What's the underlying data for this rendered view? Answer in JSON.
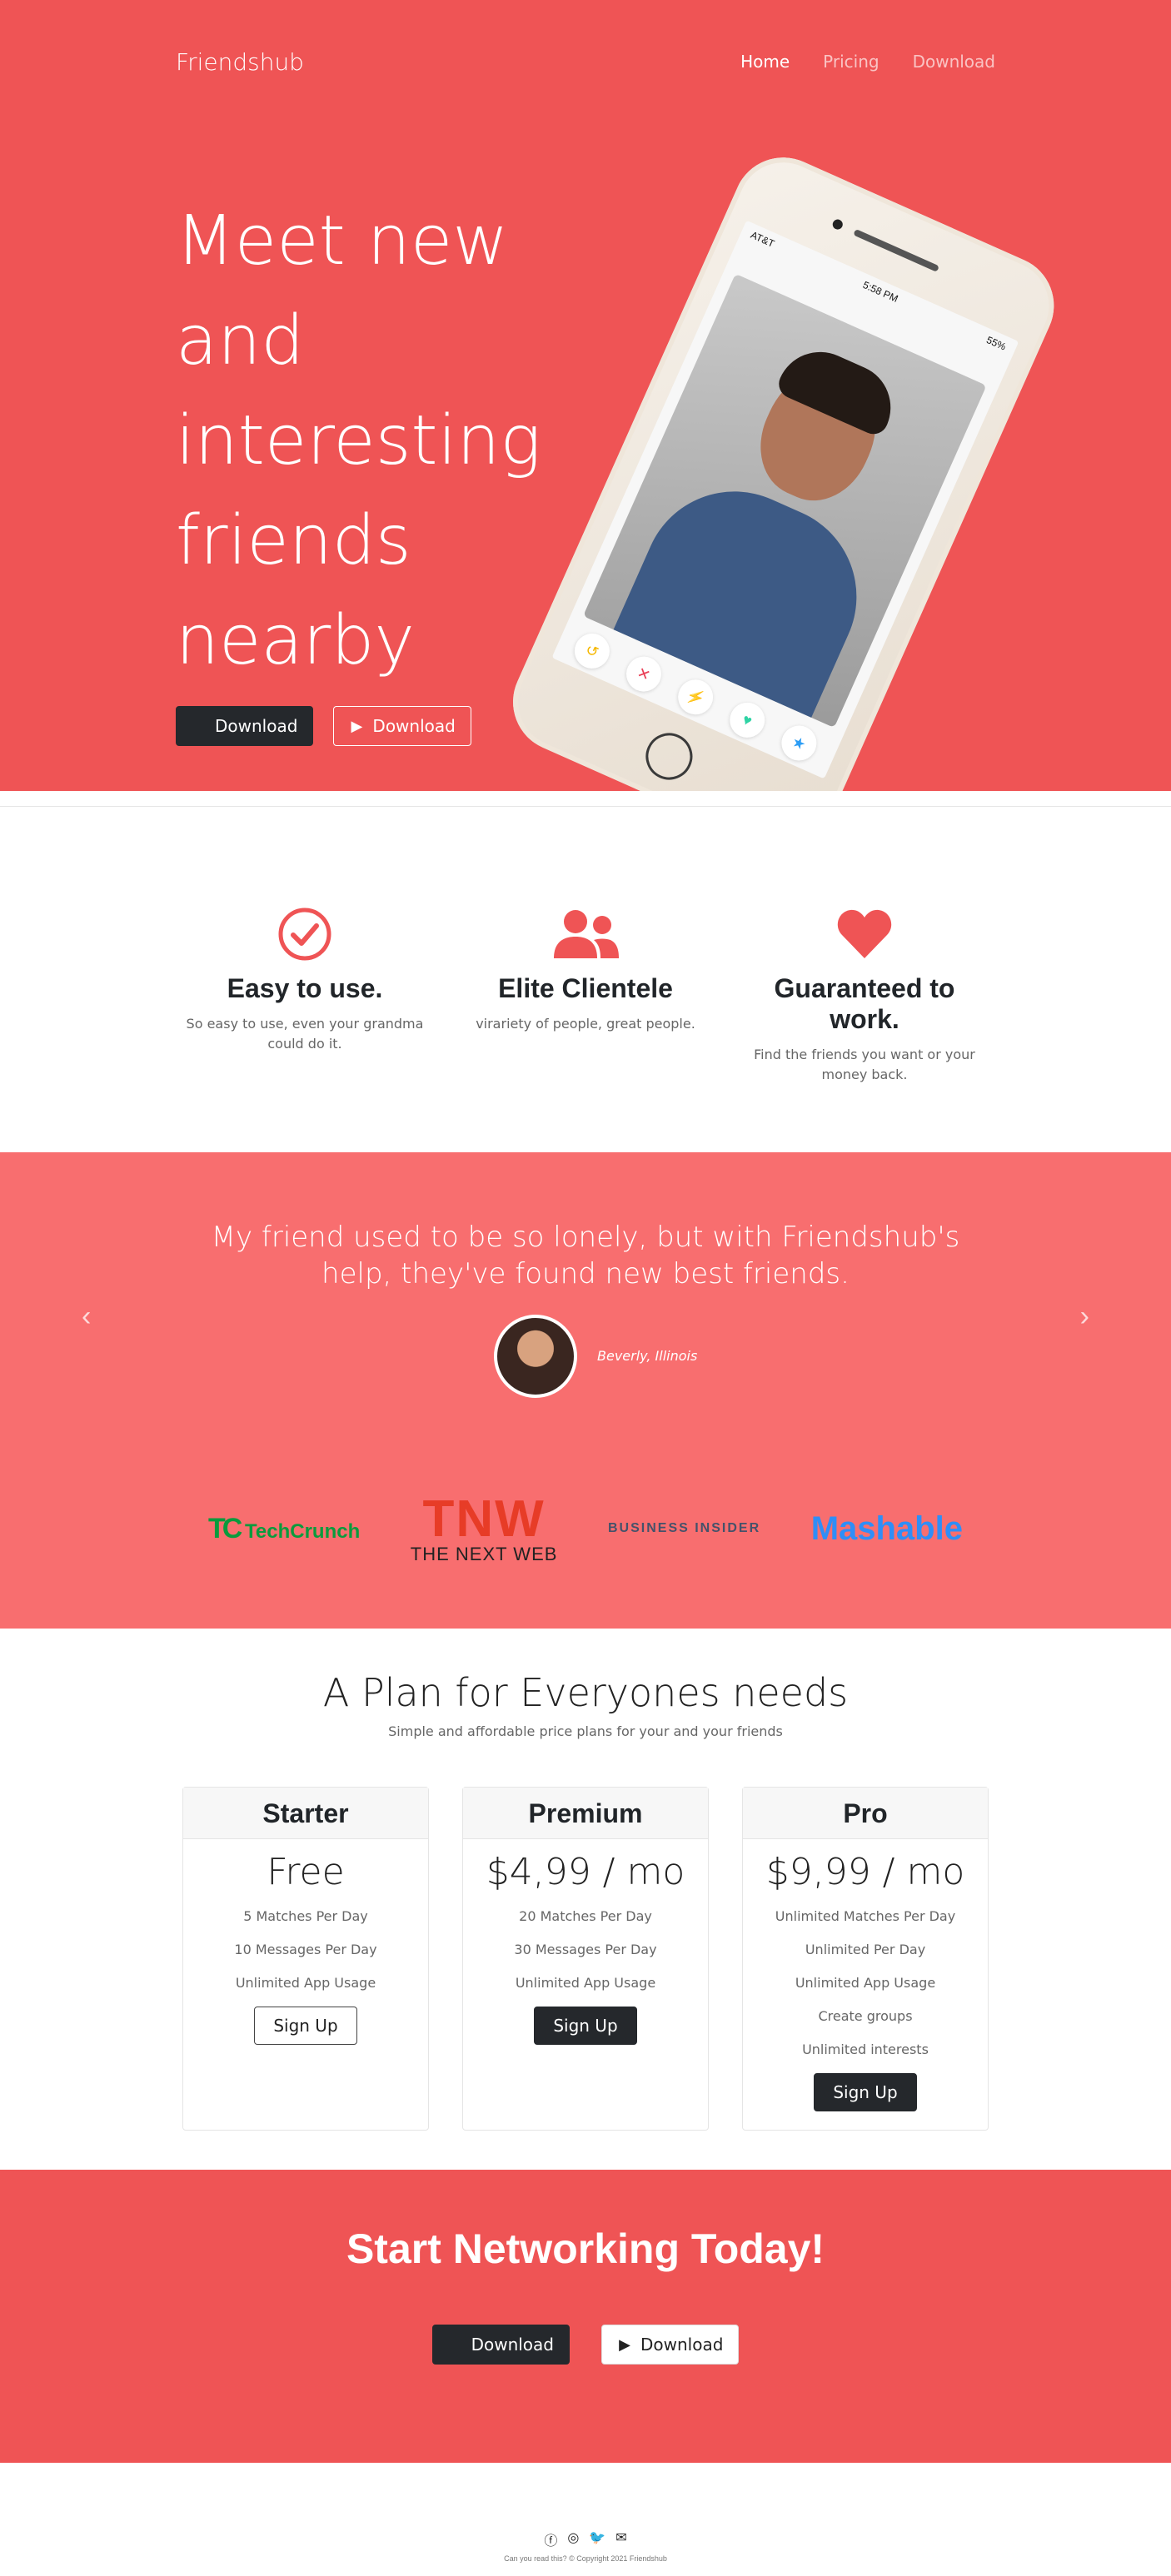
{
  "nav": {
    "brand": "Friendshub",
    "links": [
      "Home",
      "Pricing",
      "Download"
    ]
  },
  "hero": {
    "title_lines": [
      "Meet new",
      "and",
      "interesting",
      "friends",
      "nearby"
    ],
    "btn_apple": "Download",
    "btn_play": "Download"
  },
  "phone": {
    "carrier": "AT&T",
    "time": "5:58 PM",
    "battery": "55%"
  },
  "features": [
    {
      "icon": "check-circle-icon",
      "title": "Easy to use.",
      "text": "So easy to use, even your grandma could do it."
    },
    {
      "icon": "users-icon",
      "title": "Elite Clientele",
      "text": "virariety of people, great people."
    },
    {
      "icon": "heart-icon",
      "title": "Guaranteed to work.",
      "text": "Find the friends you want or your money back."
    }
  ],
  "testimonial": {
    "quote": "My friend used to be so lonely, but with Friendshub's help, they've found new best friends.",
    "author": "Beverly, Illinois"
  },
  "press": {
    "techcrunch": "TechCrunch",
    "tnw_big": "TNW",
    "tnw_small": "THE NEXT WEB",
    "bi": "BUSINESS INSIDER",
    "mashable": "Mashable"
  },
  "pricing": {
    "title": "A Plan for Everyones needs",
    "subtitle": "Simple and affordable price plans for your and your friends",
    "plans": [
      {
        "name": "Starter",
        "price": "Free",
        "features": [
          "5 Matches Per Day",
          "10 Messages Per Day",
          "Unlimited App Usage"
        ],
        "button": "Sign Up"
      },
      {
        "name": "Premium",
        "price": "$4,99 / mo",
        "features": [
          "20 Matches Per Day",
          "30 Messages Per Day",
          "Unlimited App Usage"
        ],
        "button": "Sign Up"
      },
      {
        "name": "Pro",
        "price": "$9,99 / mo",
        "features": [
          "Unlimited Matches Per Day",
          "Unlimited Per Day",
          "Unlimited App Usage",
          "Create groups",
          "Unlimited interests"
        ],
        "button": "Sign Up"
      }
    ]
  },
  "cta": {
    "title": "Start Networking Today!",
    "btn_apple": "Download",
    "btn_play": "Download"
  },
  "footer": {
    "copyright": "Can you read this? © Copyright 2021 Friendshub"
  },
  "colors": {
    "hero_red": "#ef5455",
    "testimonial_red": "#f86e6f",
    "dark": "#25282c"
  }
}
